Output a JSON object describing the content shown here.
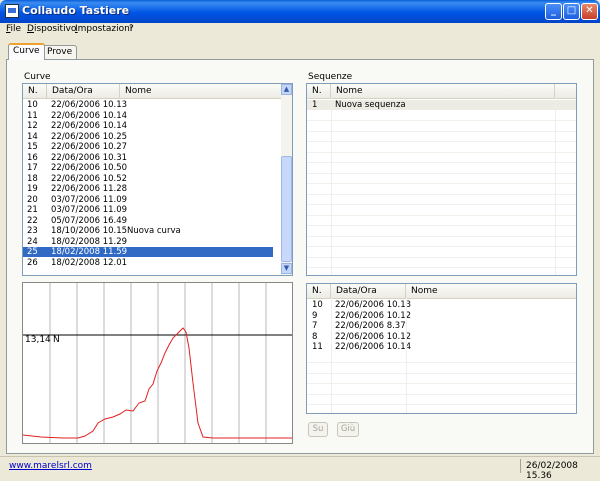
{
  "window": {
    "title": "Collaudo Tastiere"
  },
  "menu": [
    "File",
    "Dispositivo",
    "Impostazioni",
    "?"
  ],
  "tabs": [
    "Curve",
    "Prove"
  ],
  "curves": {
    "label": "Curve",
    "columns": [
      "N.",
      "Data/Ora",
      "Nome"
    ],
    "rows": [
      [
        "10",
        "22/06/2006 10.13",
        ""
      ],
      [
        "11",
        "22/06/2006 10.14",
        ""
      ],
      [
        "12",
        "22/06/2006 10.14",
        ""
      ],
      [
        "14",
        "22/06/2006 10.25",
        ""
      ],
      [
        "15",
        "22/06/2006 10.27",
        ""
      ],
      [
        "16",
        "22/06/2006 10.31",
        ""
      ],
      [
        "17",
        "22/06/2006 10.50",
        ""
      ],
      [
        "18",
        "22/06/2006 10.52",
        ""
      ],
      [
        "19",
        "22/06/2006 11.28",
        ""
      ],
      [
        "20",
        "03/07/2006 11.09",
        ""
      ],
      [
        "21",
        "03/07/2006 11.09",
        ""
      ],
      [
        "22",
        "05/07/2006 16.49",
        ""
      ],
      [
        "23",
        "18/10/2006 10.15",
        "Nuova curva"
      ],
      [
        "24",
        "18/02/2008 11.29",
        ""
      ],
      [
        "25",
        "18/02/2008 11.59",
        ""
      ],
      [
        "26",
        "18/02/2008 12.01",
        ""
      ]
    ],
    "selected_index": 14
  },
  "chart": {
    "threshold_label": "13,14",
    "unit": "N"
  },
  "sequences": {
    "label": "Sequenze",
    "columns": [
      "N.",
      "Nome"
    ],
    "rows": [
      [
        "1",
        "Nuova sequenza"
      ]
    ]
  },
  "sequence_curves": {
    "columns": [
      "N.",
      "Data/Ora",
      "Nome"
    ],
    "rows": [
      [
        "10",
        "22/06/2006 10.13",
        ""
      ],
      [
        "9",
        "22/06/2006 10.12",
        ""
      ],
      [
        "7",
        "22/06/2006 8.37",
        ""
      ],
      [
        "8",
        "22/06/2006 10.12",
        ""
      ],
      [
        "11",
        "22/06/2006 10.14",
        ""
      ]
    ]
  },
  "buttons": {
    "up": "Su",
    "down": "Giù"
  },
  "status": {
    "link": "www.marelsrl.com",
    "datetime": "26/02/2008 15.36"
  },
  "colors": {
    "curve": "#e02020",
    "selection": "#316ac5"
  }
}
